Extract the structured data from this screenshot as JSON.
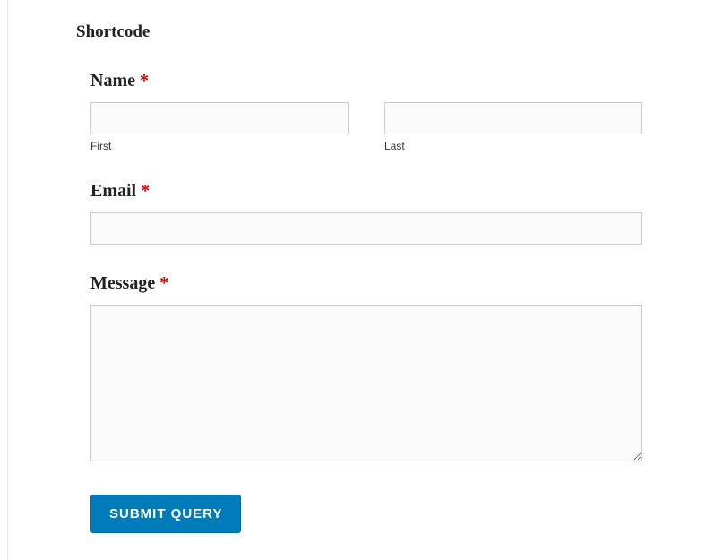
{
  "section_title": "Shortcode",
  "form": {
    "name": {
      "label": "Name",
      "required_mark": "*",
      "first_sublabel": "First",
      "last_sublabel": "Last",
      "first_value": "",
      "last_value": ""
    },
    "email": {
      "label": "Email",
      "required_mark": "*",
      "value": ""
    },
    "message": {
      "label": "Message",
      "required_mark": "*",
      "value": ""
    },
    "submit_label": "Submit Query"
  }
}
